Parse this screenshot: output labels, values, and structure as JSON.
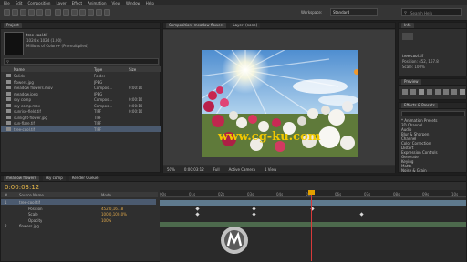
{
  "app": {
    "menu": [
      "File",
      "Edit",
      "Composition",
      "Layer",
      "Effect",
      "Animation",
      "View",
      "Window",
      "Help"
    ],
    "workspace_label": "Workspace:",
    "workspace_value": "Standard",
    "search_placeholder": "Search Help"
  },
  "project": {
    "tab": "Project",
    "selected_name": "tree-cool.tif",
    "selected_info": "1024 x 1024 (1.00)",
    "selected_detail": "Millions of Colors+ (Premultiplied)",
    "columns": [
      "Name",
      "Type",
      "Size"
    ],
    "items": [
      {
        "name": "Solids",
        "type": "Folder",
        "size": ""
      },
      {
        "name": "flowers.jpg",
        "type": "JPEG",
        "size": ""
      },
      {
        "name": "meadow flowers.mov",
        "type": "Compos...",
        "size": "0:00:10"
      },
      {
        "name": "meadow.jpeg",
        "type": "JPEG",
        "size": ""
      },
      {
        "name": "sky comp",
        "type": "Compos...",
        "size": "0:00:10"
      },
      {
        "name": "sky-comp.mov",
        "type": "Compos...",
        "size": "0:00:10"
      },
      {
        "name": "sunrise-field.tif",
        "type": "TIFF",
        "size": "0:00:10"
      },
      {
        "name": "sunlight-flower.jpg",
        "type": "TIFF",
        "size": ""
      },
      {
        "name": "sun-flare.tif",
        "type": "TIFF",
        "size": ""
      },
      {
        "name": "tree-cool.tif",
        "type": "TIFF",
        "size": ""
      }
    ]
  },
  "composition": {
    "tabs": [
      "Composition: meadow flowers",
      "Layer: (none)"
    ],
    "footer": [
      "50%",
      "0:00:03:12",
      "Full",
      "Active Camera",
      "1 View"
    ],
    "watermark": "www.cg-ku.com"
  },
  "info": {
    "tab": "Info",
    "lines": [
      "tree-cool.tif",
      "Position: 452, 167.8",
      "Scale: 100%"
    ]
  },
  "preview": {
    "tab": "Preview"
  },
  "effects": {
    "tab": "Effects & Presets",
    "items": [
      "* Animation Presets",
      "3D Channel",
      "Audio",
      "Blur & Sharpen",
      "Channel",
      "Color Correction",
      "Distort",
      "Expression Controls",
      "Generate",
      "Keying",
      "Matte",
      "Noise & Grain"
    ]
  },
  "timeline": {
    "timecode": "0:00:03:12",
    "tabs": [
      "meadow flowers",
      "sky comp",
      "Render Queue"
    ],
    "columns": [
      "#",
      "Source Name",
      "Mode"
    ],
    "layers": [
      {
        "num": "1",
        "name": "tree-cool.tif",
        "selected": true
      },
      {
        "num": "",
        "name": "Position",
        "value": "452.0,167.8"
      },
      {
        "num": "",
        "name": "Scale",
        "value": "100.0,100.0%"
      },
      {
        "num": "",
        "name": "Opacity",
        "value": "100%"
      },
      {
        "num": "2",
        "name": "flowers.jpg",
        "selected": false
      }
    ],
    "ruler": [
      "00s",
      "01s",
      "02s",
      "03s",
      "04s",
      "05s",
      "06s",
      "07s",
      "08s",
      "09s",
      "10s"
    ]
  }
}
